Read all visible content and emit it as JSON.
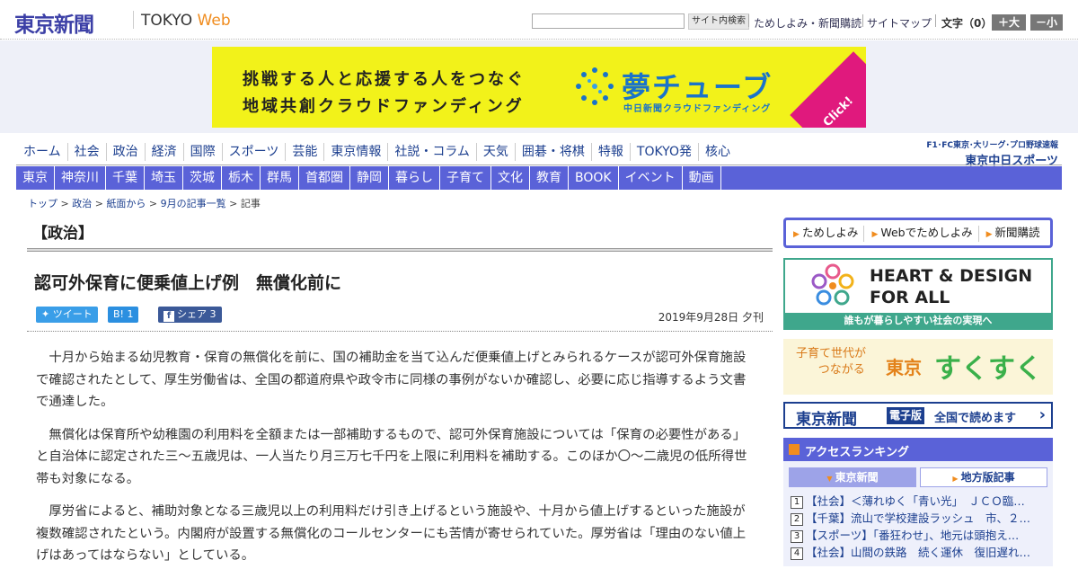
{
  "header": {
    "logo": "東京新聞",
    "logo_sub_a": "TOKYO ",
    "logo_sub_b": "Web",
    "search_button": "サイト内検索",
    "search_placeholder": "",
    "link_trial": "ためしよみ・新聞購読",
    "link_sitemap": "サイトマップ",
    "font_size_label": "文字（0）",
    "font_bigger": "＋大",
    "font_smaller": "－小"
  },
  "banner": {
    "line1": "挑戦する人と応援する人をつなぐ",
    "line2": "地域共創クラウドファンディング",
    "logo": "夢チューブ",
    "logo_sub": "中日新聞クラウドファンディング",
    "click": "Click!"
  },
  "nav_primary": [
    "ホーム",
    "社会",
    "政治",
    "経済",
    "国際",
    "スポーツ",
    "芸能",
    "東京情報",
    "社説・コラム",
    "天気",
    "囲碁・将棋",
    "特報",
    "TOKYO発",
    "核心"
  ],
  "chunichi": {
    "top": "F1･FC東京･大リーグ･プロ野球速報",
    "logo": "東京中日スポーツ"
  },
  "nav_secondary": [
    "東京",
    "神奈川",
    "千葉",
    "埼玉",
    "茨城",
    "栃木",
    "群馬",
    "首都圏",
    "静岡",
    "暮らし",
    "子育て",
    "文化",
    "教育",
    "BOOK",
    "イベント",
    "動画"
  ],
  "breadcrumb": {
    "items": [
      "トップ",
      "政治",
      "紙面から",
      "9月の記事一覧"
    ],
    "current": "記事",
    "sep": " > "
  },
  "article": {
    "section": "【政治】",
    "headline": "認可外保育に便乗値上げ例　無償化前に",
    "share": {
      "tweet": "ツイート",
      "hatena": "B! 1",
      "fb": "シェア 3"
    },
    "date": "2019年9月28日 夕刊",
    "paragraphs": [
      "十月から始まる幼児教育・保育の無償化を前に、国の補助金を当て込んだ便乗値上げとみられるケースが認可外保育施設で確認されたとして、厚生労働省は、全国の都道府県や政令市に同様の事例がないか確認し、必要に応じ指導するよう文書で通達した。",
      "無償化は保育所や幼稚園の利用料を全額または一部補助するもので、認可外保育施設については「保育の必要性がある」と自治体に認定された三～五歳児は、一人当たり月三万七千円を上限に利用料を補助する。このほか〇～二歳児の低所得世帯も対象になる。",
      "厚労省によると、補助対象となる三歳児以上の利用料だけ引き上げるという施設や、十月から値上げするといった施設が複数確認されたという。内閣府が設置する無償化のコールセンターにも苦情が寄せられていた。厚労省は「理由のない値上げはあってはならない」としている。"
    ]
  },
  "sidebar": {
    "links": [
      "ためしよみ",
      "Webでためしよみ",
      "新聞購読"
    ],
    "heart_title_1": "HEART & DESIGN",
    "heart_title_2": "FOR ALL",
    "heart_sub": "誰もが暮らしやすい社会の実現へ",
    "suku_line1": "子育て世代が",
    "suku_line2": "つながる",
    "suku_tokyo": "東京",
    "suku_big": "すくすく",
    "ep_logo": "東京新聞",
    "ep_tag": "電子版",
    "ep_text": "全国で読めます",
    "ranking_title": "アクセスランキング",
    "ranking_tab1": "東京新聞",
    "ranking_tab2": "地方版記事",
    "ranking": [
      {
        "num": "1",
        "text": "【社会】＜薄れゆく「青い光」　ＪＣＯ臨…"
      },
      {
        "num": "2",
        "text": "【千葉】流山で学校建設ラッシュ　市、２…"
      },
      {
        "num": "3",
        "text": "【スポーツ】「番狂わせ」、地元は頭抱え…"
      },
      {
        "num": "4",
        "text": "【社会】山間の鉄路　続く運休　復旧遅れ…"
      }
    ]
  },
  "colors": {
    "nav_blue": "#5a62d8",
    "banner_yellow": "#f2f21a",
    "link_blue": "#1c3f8f",
    "accent_orange": "#f08c1e"
  }
}
